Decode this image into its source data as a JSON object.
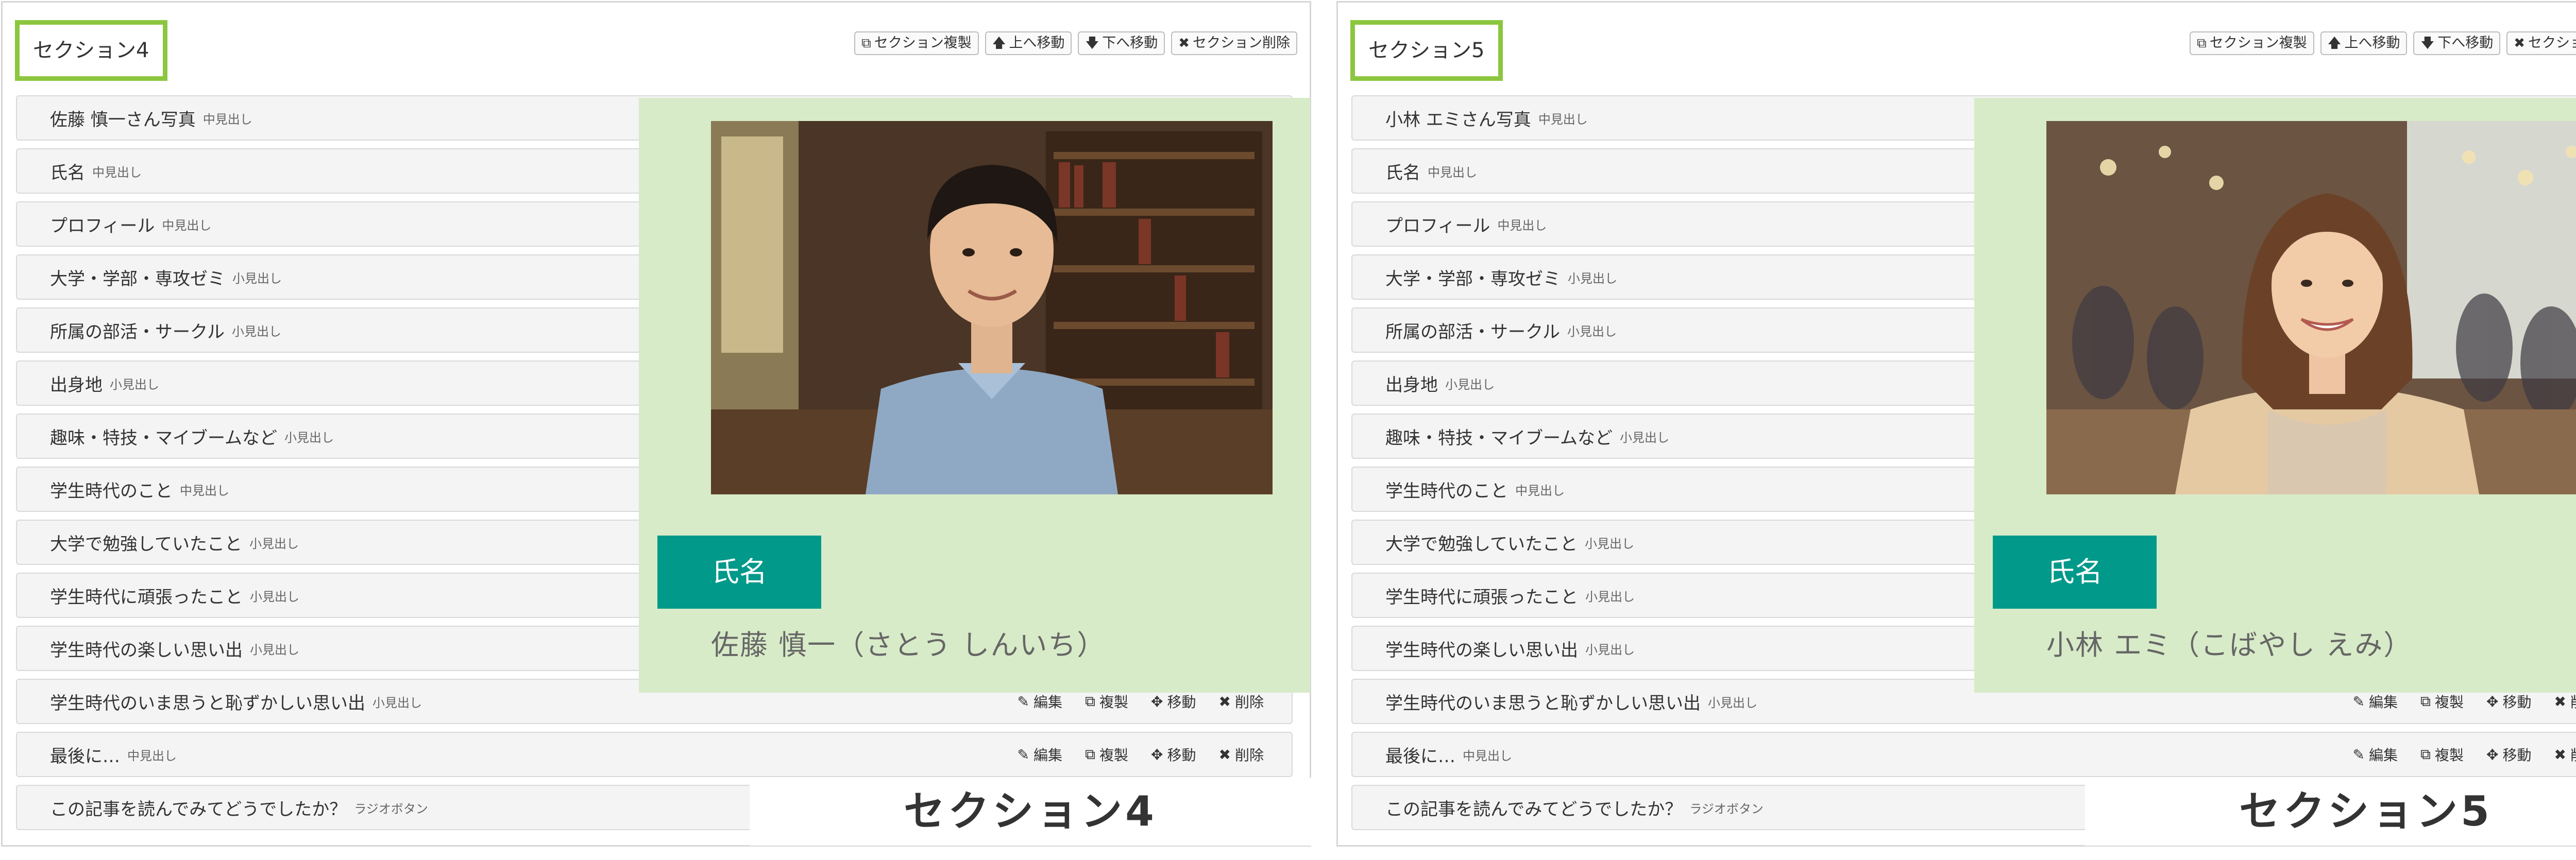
{
  "toolbar": {
    "duplicate_label": "セクション複製",
    "move_up_label": "上へ移動",
    "move_down_label": "下へ移動",
    "delete_label": "セクション削除"
  },
  "row_actions": {
    "edit_label": "編集",
    "duplicate_label": "複製",
    "move_label": "移動",
    "delete_label": "削除"
  },
  "accent_colors": {
    "section_title_border": "#8cc63f",
    "preview_background": "#d8ebc8",
    "name_heading": "#00998a"
  },
  "panels": [
    {
      "section_title": "セクション4",
      "caption": "セクション4",
      "rows": [
        {
          "title": "佐藤 慎一さん写真",
          "kind": "中見出し"
        },
        {
          "title": "氏名",
          "kind": "中見出し"
        },
        {
          "title": "プロフィール",
          "kind": "中見出し"
        },
        {
          "title": "大学・学部・専攻ゼミ",
          "kind": "小見出し"
        },
        {
          "title": "所属の部活・サークル",
          "kind": "小見出し"
        },
        {
          "title": "出身地",
          "kind": "小見出し"
        },
        {
          "title": "趣味・特技・マイブームなど",
          "kind": "小見出し"
        },
        {
          "title": "学生時代のこと",
          "kind": "中見出し"
        },
        {
          "title": "大学で勉強していたこと",
          "kind": "小見出し"
        },
        {
          "title": "学生時代に頑張ったこと",
          "kind": "小見出し"
        },
        {
          "title": "学生時代の楽しい思い出",
          "kind": "小見出し"
        },
        {
          "title": "学生時代のいま思うと恥ずかしい思い出",
          "kind": "小見出し"
        },
        {
          "title": "最後に…",
          "kind": "中見出し"
        },
        {
          "title": "この記事を読んでみてどうでしたか？",
          "kind": "ラジオボタン"
        }
      ],
      "preview": {
        "photo": "portrait-photo-young-man-library",
        "name_heading": "氏名",
        "name_value": "佐藤 慎一（さとう しんいち）"
      }
    },
    {
      "section_title": "セクション5",
      "caption": "セクション5",
      "rows": [
        {
          "title": "小林 エミさん写真",
          "kind": "中見出し"
        },
        {
          "title": "氏名",
          "kind": "中見出し"
        },
        {
          "title": "プロフィール",
          "kind": "中見出し"
        },
        {
          "title": "大学・学部・専攻ゼミ",
          "kind": "小見出し"
        },
        {
          "title": "所属の部活・サークル",
          "kind": "小見出し"
        },
        {
          "title": "出身地",
          "kind": "小見出し"
        },
        {
          "title": "趣味・特技・マイブームなど",
          "kind": "小見出し"
        },
        {
          "title": "学生時代のこと",
          "kind": "中見出し"
        },
        {
          "title": "大学で勉強していたこと",
          "kind": "小見出し"
        },
        {
          "title": "学生時代に頑張ったこと",
          "kind": "小見出し"
        },
        {
          "title": "学生時代の楽しい思い出",
          "kind": "小見出し"
        },
        {
          "title": "学生時代のいま思うと恥ずかしい思い出",
          "kind": "小見出し"
        },
        {
          "title": "最後に…",
          "kind": "中見出し"
        },
        {
          "title": "この記事を読んでみてどうでしたか？",
          "kind": "ラジオボタン"
        }
      ],
      "preview": {
        "photo": "portrait-photo-young-woman-cafe",
        "name_heading": "氏名",
        "name_value": "小林 エミ（こばやし えみ）"
      }
    }
  ]
}
